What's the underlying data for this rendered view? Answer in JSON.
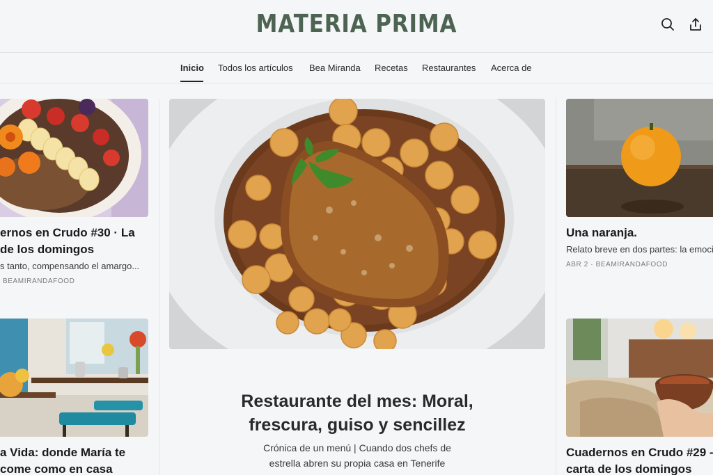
{
  "header": {
    "brand": "MATERIA PRIMA",
    "search_icon": "search-icon",
    "share_icon": "share-icon"
  },
  "nav": {
    "items": [
      "Inicio",
      "Todos los artículos",
      "Bea Miranda",
      "Recetas",
      "Restaurantes",
      "Acerca de"
    ],
    "active": "Inicio"
  },
  "left_column": {
    "card1": {
      "title_line1": "ernos en Crudo #30 · La",
      "title_line2": "de los domingos",
      "subtitle": "s tanto, compensando el amargo...",
      "meta": "BEAMIRANDAFOOD"
    },
    "card2": {
      "title_line1": "a Vida: donde María te",
      "title_line2": "come como en casa"
    }
  },
  "featured": {
    "title_line1": "Restaurante del mes: Moral,",
    "title_line2": "frescura, guiso y sencillez",
    "subtitle_line1": "Crónica de un menú | Cuando dos chefs de",
    "subtitle_line2": "estrella abren su propia casa en Tenerife"
  },
  "right_column": {
    "card1": {
      "title": "Una naranja.",
      "subtitle": "Relato breve en dos partes: la emoci",
      "meta": "ABR 2 · BEAMIRANDAFOOD"
    },
    "card2": {
      "title_line1": "Cuadernos en Crudo #29 -",
      "title_line2": "carta de los domingos"
    }
  },
  "colors": {
    "brand": "#4d6452",
    "background": "#f5f6f8",
    "divider": "#e3e4e6"
  }
}
